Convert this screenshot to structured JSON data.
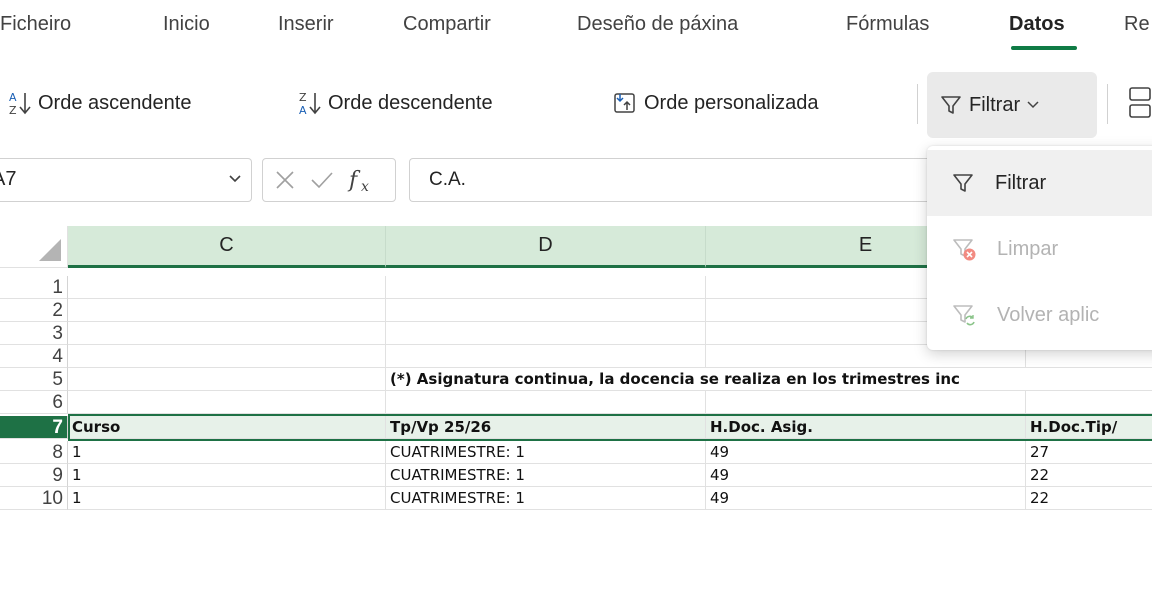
{
  "tabs": [
    {
      "label": "Ficheiro"
    },
    {
      "label": "Inicio"
    },
    {
      "label": "Inserir"
    },
    {
      "label": "Compartir"
    },
    {
      "label": "Deseño de páxina"
    },
    {
      "label": "Fórmulas"
    },
    {
      "label": "Datos"
    },
    {
      "label": "Re"
    }
  ],
  "active_tab": "Datos",
  "ribbon": {
    "sort_asc": "Orde ascendente",
    "sort_desc": "Orde descendente",
    "sort_custom": "Orde personalizada",
    "filter": "Filtrar"
  },
  "formula_bar": {
    "name_box": "A7",
    "formula": "C.A."
  },
  "filter_menu": {
    "items": [
      {
        "label": "Filtrar",
        "enabled": true
      },
      {
        "label": "Limpar",
        "enabled": false
      },
      {
        "label": "Volver aplic",
        "enabled": false
      }
    ]
  },
  "grid": {
    "columns": [
      "C",
      "D",
      "E"
    ],
    "rows": [
      {
        "num": "1",
        "c": "",
        "d": "",
        "e": "",
        "f": ""
      },
      {
        "num": "2",
        "c": "",
        "d": "",
        "e": "",
        "f": ""
      },
      {
        "num": "3",
        "c": "",
        "d": "",
        "e": "",
        "f": ""
      },
      {
        "num": "4",
        "c": "",
        "d": "",
        "e": "",
        "f": ""
      },
      {
        "num": "5",
        "c": "",
        "d": "(*) Asignatura continua, la docencia se realiza en los trimestres inc",
        "e": "",
        "f": ""
      },
      {
        "num": "6",
        "c": "",
        "d": "",
        "e": "",
        "f": ""
      },
      {
        "num": "7",
        "c": "Curso",
        "d": "Tp/Vp 25/26",
        "e": "H.Doc. Asig.",
        "f": "H.Doc.Tip/"
      },
      {
        "num": "8",
        "c": "1",
        "d": "CUATRIMESTRE: 1",
        "e": "49",
        "f": "27"
      },
      {
        "num": "9",
        "c": "1",
        "d": "CUATRIMESTRE: 1",
        "e": "49",
        "f": "22"
      },
      {
        "num": "10",
        "c": "1",
        "d": "CUATRIMESTRE: 1",
        "e": "49",
        "f": "22"
      }
    ]
  },
  "colors": {
    "accent": "#1e7145",
    "header_selected": "#d6ead9",
    "menu_hover": "#f0f0f0"
  }
}
